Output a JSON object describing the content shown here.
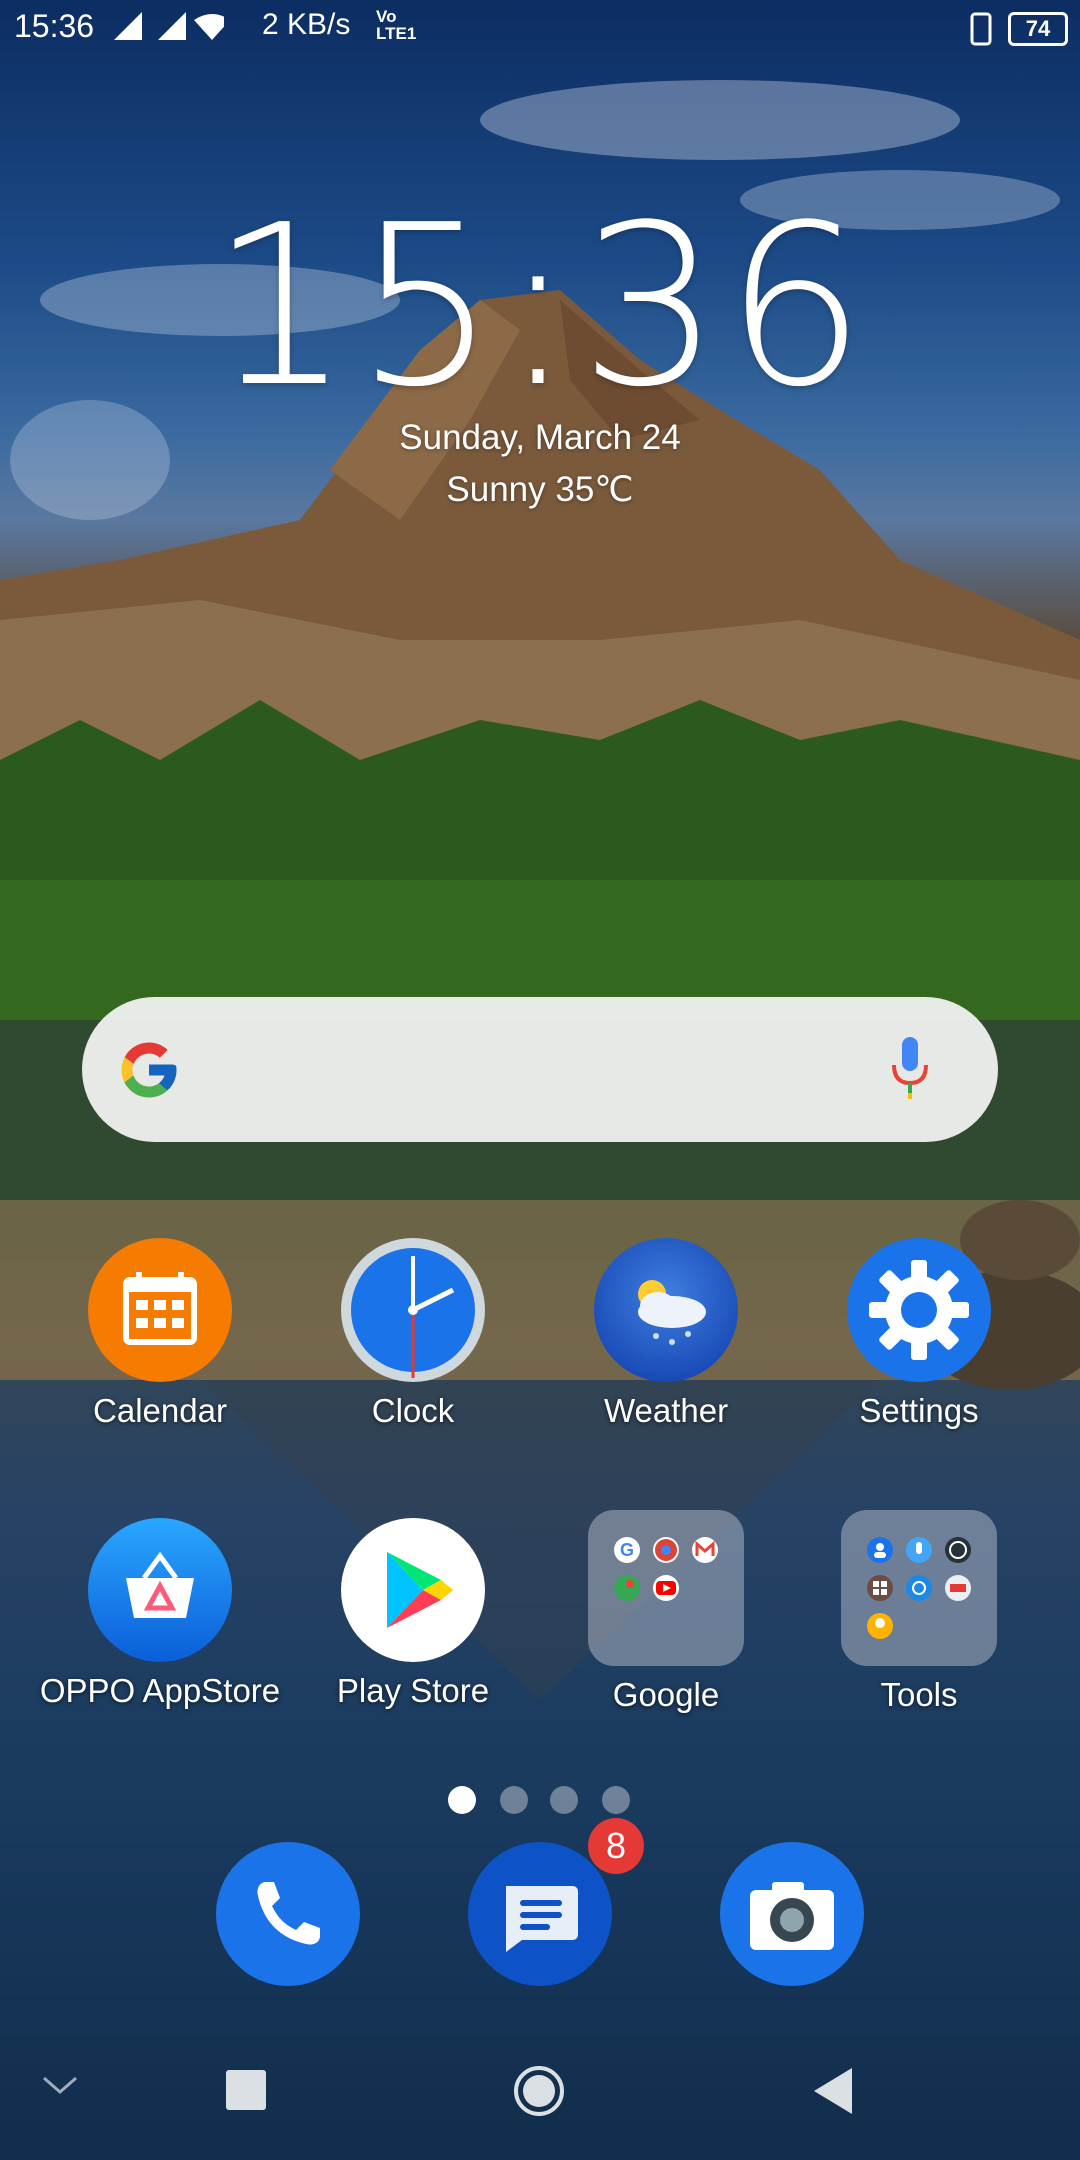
{
  "status_bar": {
    "time": "15:36",
    "network_speed": "2 KB/s",
    "volte_top": "Vo",
    "volte_bottom": "LTE1",
    "battery_level": "74"
  },
  "clock_widget": {
    "time": "15:36",
    "date": "Sunday, March 24",
    "weather": "Sunny 35℃"
  },
  "apps_row1": [
    {
      "label": "Calendar",
      "icon": "calendar-icon"
    },
    {
      "label": "Clock",
      "icon": "clock-icon"
    },
    {
      "label": "Weather",
      "icon": "weather-icon"
    },
    {
      "label": "Settings",
      "icon": "gear-icon"
    }
  ],
  "apps_row2": [
    {
      "label": "OPPO AppStore",
      "icon": "appstore-icon"
    },
    {
      "label": "Play Store",
      "icon": "play-store-icon"
    },
    {
      "label": "Google",
      "icon": "folder-icon"
    },
    {
      "label": "Tools",
      "icon": "folder-icon"
    }
  ],
  "page_indicator": {
    "pages": 4,
    "current": 1
  },
  "dock": {
    "messages_badge": "8"
  },
  "colors": {
    "accent_blue": "#1a73e8",
    "badge_red": "#e53935",
    "calendar_orange": "#f57c00"
  }
}
